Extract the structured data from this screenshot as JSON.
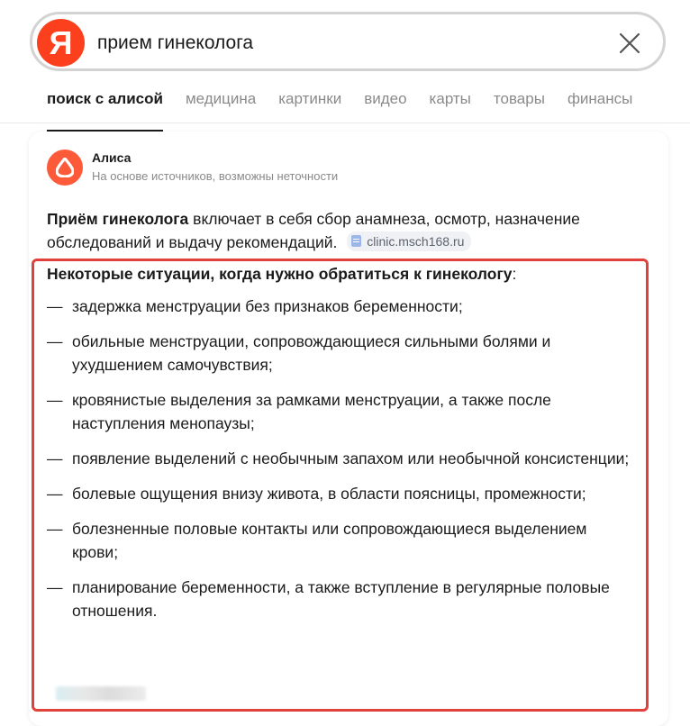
{
  "search": {
    "logo_letter": "Я",
    "query": "прием гинеколога"
  },
  "tabs": [
    {
      "label": "поиск с алисой",
      "active": true
    },
    {
      "label": "медицина",
      "active": false
    },
    {
      "label": "картинки",
      "active": false
    },
    {
      "label": "видео",
      "active": false
    },
    {
      "label": "карты",
      "active": false
    },
    {
      "label": "товары",
      "active": false
    },
    {
      "label": "финансы",
      "active": false
    }
  ],
  "alisa": {
    "name": "Алиса",
    "subtitle": "На основе источников, возможны неточности",
    "intro_bold": "Приём гинеколога",
    "intro_text": " включает в себя сбор анамнеза, осмотр, назначение обследований и выдачу рекомендаций.",
    "source": "clinic.msch168.ru"
  },
  "situations": {
    "heading_bold": "Некоторые ситуации, когда нужно обратиться к гинекологу",
    "heading_tail": ":",
    "dash": "—",
    "items": [
      "задержка менструации без признаков беременности;",
      "обильные менструации, сопровождающиеся сильными болями и ухудшением самочувствия;",
      "кровянистые выделения за рамками менструации, а также после наступления менопаузы;",
      "появление выделений с необычным запахом или необычной консистенции;",
      "болевые ощущения внизу живота, в области поясницы, промежности;",
      "болезненные половые контакты или сопровождающиеся выделением крови;",
      "планирование беременности, а также вступление в регулярные половые отношения."
    ]
  },
  "colors": {
    "brand": "#fc3f1d",
    "alisa": "#fd5a3a",
    "highlight": "#e0413b",
    "muted_text": "#8a8a8a"
  },
  "icons": {
    "logo": "yandex-logo",
    "clear": "close-icon",
    "alisa": "alisa-icon",
    "source": "document-icon"
  }
}
